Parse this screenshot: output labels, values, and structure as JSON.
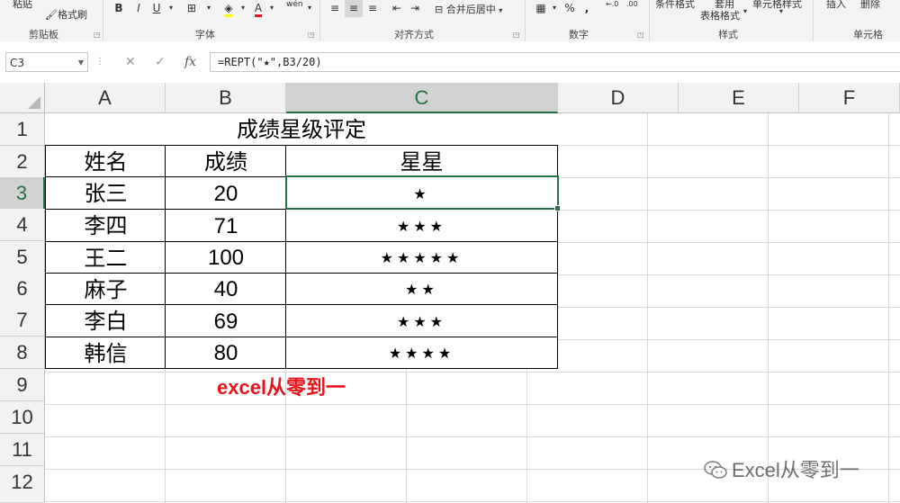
{
  "ribbon": {
    "paste_label": "粘贴",
    "format_painter_label": "格式刷",
    "clipboard_group": "剪贴板",
    "bold": "B",
    "italic": "I",
    "underline": "U",
    "font_group": "字体",
    "pinyin": "wén",
    "merge_center_label": "合并后居中",
    "align_group": "对齐方式",
    "percent": "%",
    "comma": ",",
    "number_group": "数字",
    "cond_format_label": "条件格式",
    "table_format_label_1": "套用",
    "table_format_label_2": "表格格式",
    "cell_style_label": "单元格样式",
    "styles_group": "样式",
    "insert_label": "插入",
    "delete_label": "删除",
    "cells_group": "单元格"
  },
  "formula_bar": {
    "name_box": "C3",
    "cancel": "✕",
    "confirm": "✓",
    "fx": "fx",
    "formula": "=REPT(\"★\",B3/20)"
  },
  "columns": [
    "A",
    "B",
    "C",
    "D",
    "E",
    "F"
  ],
  "rows": [
    "1",
    "2",
    "3",
    "4",
    "5",
    "6",
    "7",
    "8",
    "9",
    "10",
    "11",
    "12"
  ],
  "sheet": {
    "title": "成绩星级评定",
    "headers": [
      "姓名",
      "成绩",
      "星星"
    ],
    "records": [
      {
        "name": "张三",
        "score": "20",
        "stars": "★"
      },
      {
        "name": "李四",
        "score": "71",
        "stars": "★★★"
      },
      {
        "name": "王二",
        "score": "100",
        "stars": "★★★★★"
      },
      {
        "name": "麻子",
        "score": "40",
        "stars": "★★"
      },
      {
        "name": "李白",
        "score": "69",
        "stars": "★★★"
      },
      {
        "name": "韩信",
        "score": "80",
        "stars": "★★★★"
      }
    ],
    "note": "excel从零到一"
  },
  "watermark": "Excel从零到一",
  "colors": {
    "accent": "#217346",
    "note": "#e8141b"
  }
}
